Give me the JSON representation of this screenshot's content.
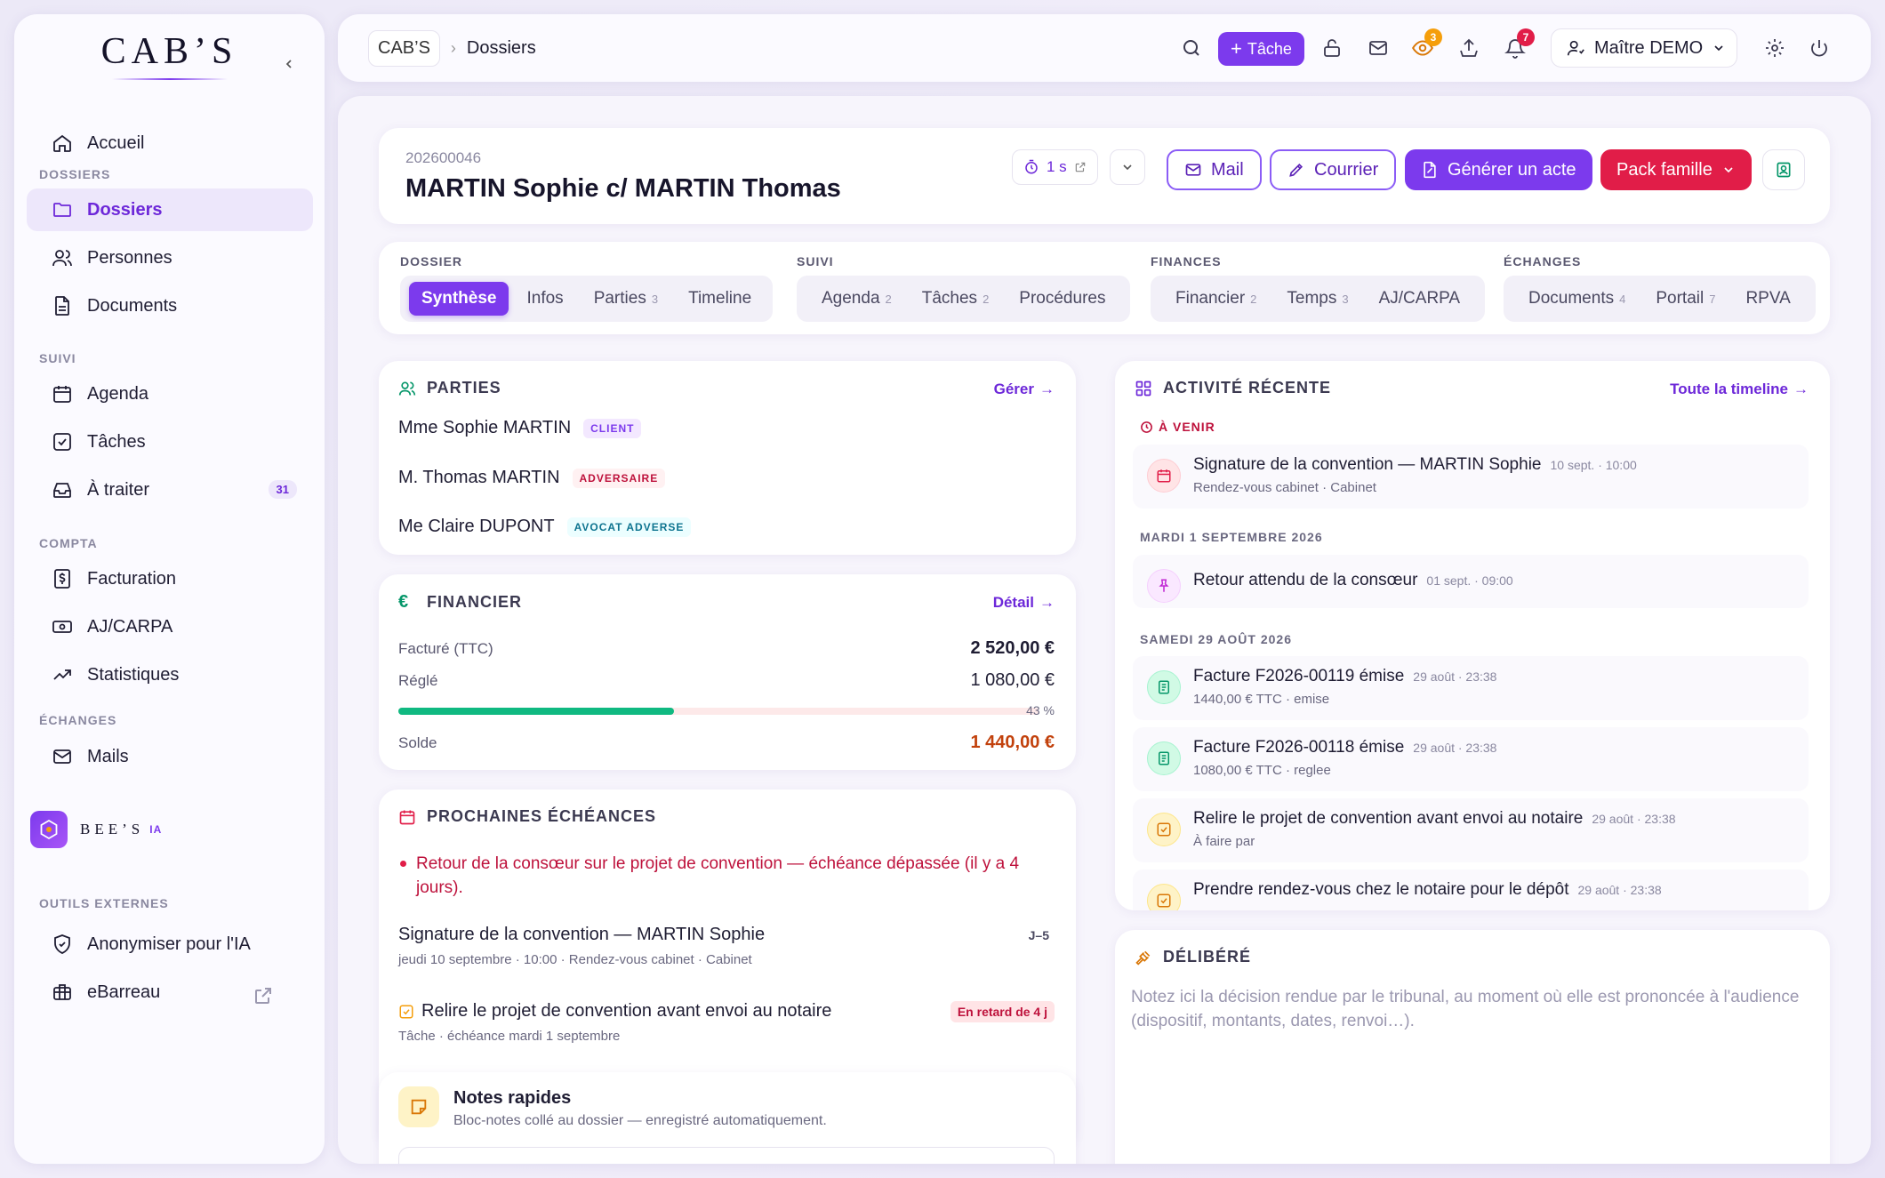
{
  "sidebar": {
    "logo": "CAB’S",
    "sections": {
      "dossiers": "DOSSIERS",
      "suivi": "SUIVI",
      "compta": "COMPTA",
      "echanges": "ÉCHANGES",
      "outils": "OUTILS EXTERNES"
    },
    "items": {
      "accueil": "Accueil",
      "dossiers": "Dossiers",
      "personnes": "Personnes",
      "documents": "Documents",
      "agenda": "Agenda",
      "taches": "Tâches",
      "a_traiter": "À traiter",
      "a_traiter_count": "31",
      "facturation": "Facturation",
      "ajcarpa": "AJ/CARPA",
      "statistiques": "Statistiques",
      "mails": "Mails",
      "anonymiser": "Anonymiser pour l'IA",
      "ebarreau": "eBarreau"
    },
    "bees": {
      "name": "BEE’S",
      "ia": "IA"
    }
  },
  "topbar": {
    "breadcrumb": {
      "home": "CAB’S",
      "current": "Dossiers"
    },
    "tache_button": "Tâche",
    "eye_badge": "3",
    "bell_badge": "7",
    "user": "Maître DEMO"
  },
  "header": {
    "number": "202600046",
    "title": "MARTIN Sophie c/ MARTIN Thomas",
    "timer": "1 s",
    "buttons": {
      "mail": "Mail",
      "courrier": "Courrier",
      "generer": "Générer un acte",
      "pack": "Pack famille"
    }
  },
  "tabs": {
    "dossier": {
      "label": "DOSSIER",
      "items": [
        {
          "label": "Synthèse",
          "count": ""
        },
        {
          "label": "Infos",
          "count": ""
        },
        {
          "label": "Parties",
          "count": "3"
        },
        {
          "label": "Timeline",
          "count": ""
        }
      ]
    },
    "suivi": {
      "label": "SUIVI",
      "items": [
        {
          "label": "Agenda",
          "count": "2"
        },
        {
          "label": "Tâches",
          "count": "2"
        },
        {
          "label": "Procédures",
          "count": ""
        }
      ]
    },
    "finances": {
      "label": "FINANCES",
      "items": [
        {
          "label": "Financier",
          "count": "2"
        },
        {
          "label": "Temps",
          "count": "3"
        },
        {
          "label": "AJ/CARPA",
          "count": ""
        }
      ]
    },
    "echanges": {
      "label": "ÉCHANGES",
      "items": [
        {
          "label": "Documents",
          "count": "4"
        },
        {
          "label": "Portail",
          "count": "7"
        },
        {
          "label": "RPVA",
          "count": ""
        }
      ]
    }
  },
  "parties": {
    "title": "PARTIES",
    "link": "Gérer",
    "list": [
      {
        "name": "Mme Sophie MARTIN",
        "role": "CLIENT"
      },
      {
        "name": "M. Thomas MARTIN",
        "role": "ADVERSAIRE"
      },
      {
        "name": "Me Claire DUPONT",
        "role": "AVOCAT ADVERSE"
      }
    ]
  },
  "financier": {
    "title": "FINANCIER",
    "link": "Détail",
    "facture_label": "Facturé (TTC)",
    "facture_value": "2 520,00 €",
    "regle_label": "Réglé",
    "regle_value": "1 080,00 €",
    "progress_pct": 43,
    "progress_text": "43 %",
    "solde_label": "Solde",
    "solde_value": "1 440,00 €",
    "colors": {
      "progress": "#10b981",
      "solde": "#c2410c"
    }
  },
  "echeances": {
    "title": "PROCHAINES ÉCHÉANCES",
    "alert": "Retour de la consœur sur le projet de convention — échéance dépassée (il y a 4 jours).",
    "items": [
      {
        "title": "Signature de la convention — MARTIN Sophie",
        "sub": "jeudi 10 septembre · 10:00 · Rendez-vous cabinet · Cabinet",
        "badge": "J–5"
      },
      {
        "title": "Relire le projet de convention avant envoi au notaire",
        "sub": "Tâche · échéance mardi 1 septembre",
        "badge": "En retard de 4 j"
      }
    ]
  },
  "notes": {
    "title": "Notes rapides",
    "sub": "Bloc-notes collé au dossier — enregistré automatiquement."
  },
  "activite": {
    "title": "ACTIVITÉ RÉCENTE",
    "link": "Toute la timeline",
    "upcoming": "À VENIR",
    "day1": "MARDI 1 SEPTEMBRE 2026",
    "day2": "SAMEDI 29 AOÛT 2026",
    "items": [
      {
        "title": "Signature de la convention — MARTIN Sophie",
        "time": "10 sept. · 10:00",
        "sub": "Rendez-vous cabinet · Cabinet",
        "icon": "calendar-icon"
      },
      {
        "title": "Retour attendu de la consœur",
        "time": "01 sept. · 09:00",
        "sub": "",
        "icon": "pin-icon"
      },
      {
        "title": "Facture F2026-00119 émise",
        "time": "29 août · 23:38",
        "sub": "1440,00 € TTC · emise",
        "icon": "invoice-icon"
      },
      {
        "title": "Facture F2026-00118 émise",
        "time": "29 août · 23:38",
        "sub": "1080,00 € TTC · reglee",
        "icon": "invoice-icon"
      },
      {
        "title": "Relire le projet de convention avant envoi au notaire",
        "time": "29 août · 23:38",
        "sub": "À faire par",
        "icon": "task-icon"
      },
      {
        "title": "Prendre rendez-vous chez le notaire pour le dépôt",
        "time": "29 août · 23:38",
        "sub": "",
        "icon": "task-icon"
      }
    ]
  },
  "delibere": {
    "title": "DÉLIBÉRÉ",
    "placeholder": "Notez ici la décision rendue par le tribunal, au moment où elle est prononcée à l'audience (dispositif, montants, dates, renvoi…)."
  }
}
